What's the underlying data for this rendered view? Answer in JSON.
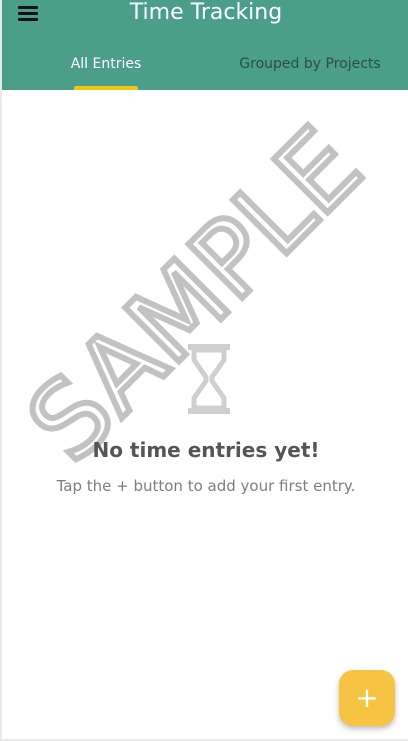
{
  "app": {
    "title": "Time Tracking"
  },
  "tabs": [
    {
      "label": "All Entries",
      "active": true
    },
    {
      "label": "Grouped by Projects",
      "active": false
    }
  ],
  "watermark": {
    "text": "SAMPLE"
  },
  "empty_state": {
    "icon": "hourglass-icon",
    "title": "No time entries yet!",
    "subtitle": "Tap the + button to add your first entry."
  },
  "fab": {
    "label": "+"
  },
  "colors": {
    "appbar": "#4a9e8a",
    "accent": "#f6c343",
    "indicator": "#f1c40f"
  }
}
